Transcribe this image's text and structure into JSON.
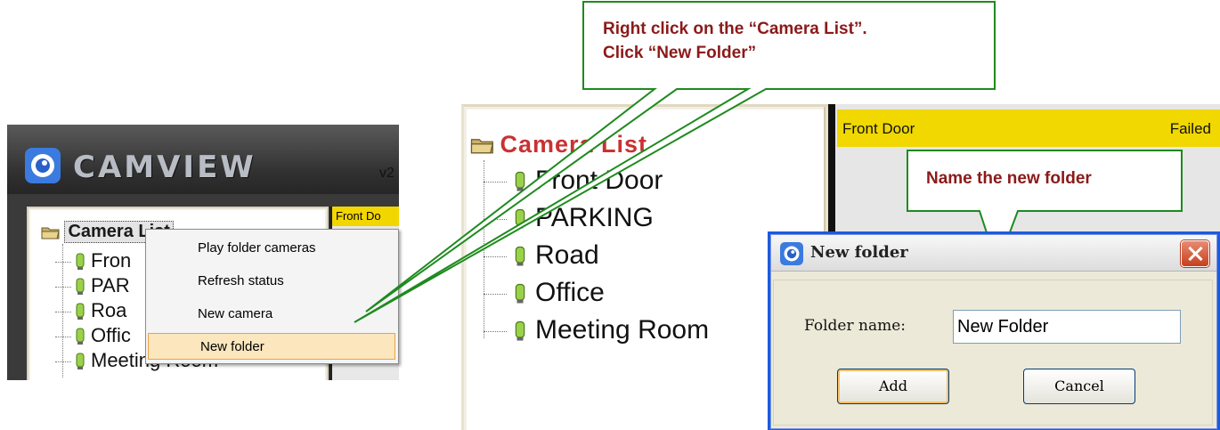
{
  "left": {
    "brand": "CAMVIEW",
    "version": "v2",
    "root_label": "Camera List",
    "items": [
      "Fron",
      "PAR",
      "Roa",
      "Offic",
      "Meeting Room"
    ],
    "status_header": "Front Do"
  },
  "context_menu": {
    "items": [
      "Play folder cameras",
      "Refresh status",
      "New camera",
      "New folder"
    ],
    "highlighted": "New folder"
  },
  "middle": {
    "root_label": "Camera List",
    "items": [
      "Front Door",
      "PARKING",
      "Road",
      "Office",
      "Meeting Room"
    ]
  },
  "right": {
    "status_name": "Front Door",
    "status_value": "Failed"
  },
  "dialog": {
    "title": "New folder",
    "field_label": "Folder name:",
    "field_value": "New Folder",
    "add_label": "Add",
    "cancel_label": "Cancel"
  },
  "callouts": {
    "top_line1": "Right click on the “Camera List”.",
    "top_line2": "Click “New Folder”",
    "name_folder": "Name the new folder"
  },
  "colors": {
    "callout_text": "#8b1a1a",
    "callout_border": "#1e8a1e",
    "status_yellow": "#f0d800",
    "middle_root_red": "#c83232"
  }
}
